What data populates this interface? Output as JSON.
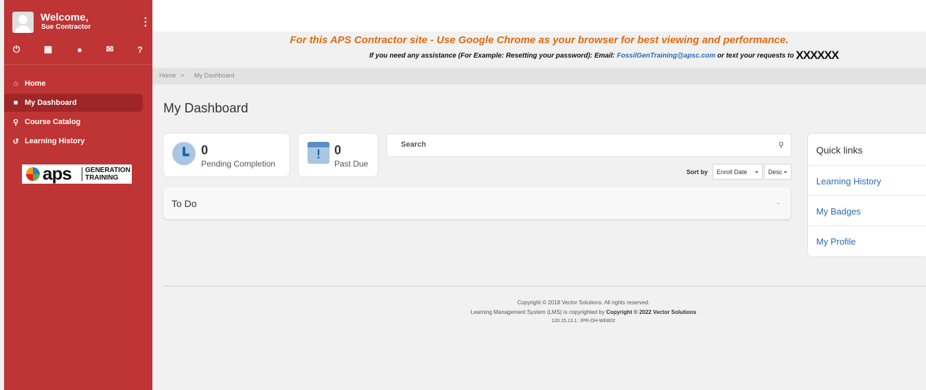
{
  "sidebar": {
    "welcome": "Welcome,",
    "user_name": "Sue Contractor",
    "menu_icon": "kebab-icon",
    "toolbar_icons": [
      "power-icon",
      "calendar-icon",
      "badge-icon",
      "mail-icon",
      "help-icon"
    ],
    "nav": [
      {
        "label": "Home",
        "icon": "home-icon"
      },
      {
        "label": "My Dashboard",
        "icon": "dashboard-icon",
        "active": true
      },
      {
        "label": "Course Catalog",
        "icon": "search-icon"
      },
      {
        "label": "Learning History",
        "icon": "history-icon"
      }
    ],
    "logo": {
      "aps": "aps",
      "gen_line1": "GENERATION",
      "gen_line2": "TRAINING"
    }
  },
  "notice": {
    "line1": "For this APS Contractor site - Use Google Chrome as your browser for best viewing and performance.",
    "line2_prefix": "If you need any assistance (For Example: Resetting your password): Email: ",
    "email": "FossilGenTraining@apsc.com",
    "line2_suffix": " or text your requests to ",
    "masked": "XXXXXX"
  },
  "breadcrumb": {
    "home": "Home",
    "sep": ">",
    "current": "My Dashboard"
  },
  "page_title": "My Dashboard",
  "stats": [
    {
      "count": "0",
      "label": "Pending Completion"
    },
    {
      "count": "0",
      "label": "Past Due"
    }
  ],
  "search": {
    "placeholder": "Search"
  },
  "sort": {
    "label": "Sort by",
    "field": "Enroll Date",
    "order": "Desc"
  },
  "todo": {
    "label": "To Do"
  },
  "quick_links": {
    "title": "Quick links",
    "items": [
      "Learning History",
      "My Badges",
      "My Profile"
    ]
  },
  "footer": {
    "line1": "Copyright © 2018 Vector Solutions. All rights reserved.",
    "line2_prefix": "Learning Management System (LMS) is copyrighted by ",
    "line2_bold": "Copyright © 2022 Vector Solutions",
    "line3": "120.15.13.1: JPR-OH-WEB02"
  },
  "colors": {
    "sidebar": "#bf3434",
    "sidebar_active": "#9e2626",
    "notice": "#e06b12",
    "link": "#2a6bb5"
  }
}
